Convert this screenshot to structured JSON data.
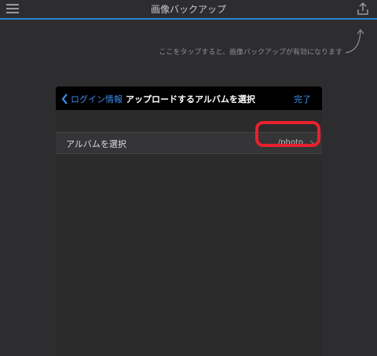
{
  "app": {
    "title": "画像バックアップ"
  },
  "hint": {
    "text": "ここをタップすると、画像バックアップが有効になります"
  },
  "modal": {
    "back_label": "ログイン情報",
    "title": "アップロードするアルバムを選択",
    "done_label": "完了",
    "row": {
      "label": "アルバムを選択",
      "value": "/photo"
    }
  },
  "colors": {
    "accent": "#3b8fe8",
    "highlight": "#e8212c",
    "background": "#2d2d2f"
  },
  "icons": {
    "menu": "hamburger-menu-icon",
    "upload": "upload-icon",
    "back": "chevron-left-icon",
    "row_chevron": "chevron-right-icon",
    "hint_arrow": "curved-arrow-icon"
  }
}
